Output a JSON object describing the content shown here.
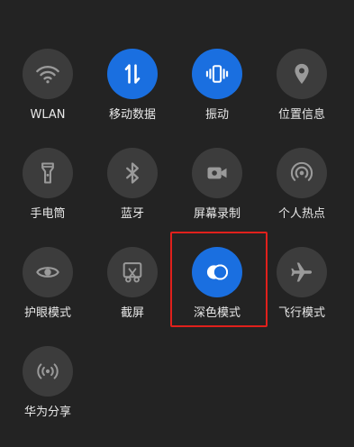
{
  "tiles": [
    {
      "label": "WLAN",
      "icon": "wifi-icon",
      "active": false
    },
    {
      "label": "移动数据",
      "icon": "mobile-data-icon",
      "active": true
    },
    {
      "label": "振动",
      "icon": "vibrate-icon",
      "active": true
    },
    {
      "label": "位置信息",
      "icon": "location-icon",
      "active": false
    },
    {
      "label": "手电筒",
      "icon": "flashlight-icon",
      "active": false
    },
    {
      "label": "蓝牙",
      "icon": "bluetooth-icon",
      "active": false
    },
    {
      "label": "屏幕录制",
      "icon": "screen-record-icon",
      "active": false
    },
    {
      "label": "个人热点",
      "icon": "hotspot-icon",
      "active": false
    },
    {
      "label": "护眼模式",
      "icon": "eye-comfort-icon",
      "active": false
    },
    {
      "label": "截屏",
      "icon": "screenshot-icon",
      "active": false
    },
    {
      "label": "深色模式",
      "icon": "dark-mode-icon",
      "active": true
    },
    {
      "label": "飞行模式",
      "icon": "airplane-icon",
      "active": false
    },
    {
      "label": "华为分享",
      "icon": "huawei-share-icon",
      "active": false
    }
  ],
  "colors": {
    "background": "#232323",
    "tile_off": "#3c3c3c",
    "tile_on": "#1a6fe0",
    "icon_off": "#9a9a9a",
    "icon_on": "#ffffff",
    "highlight": "#e0201c"
  }
}
